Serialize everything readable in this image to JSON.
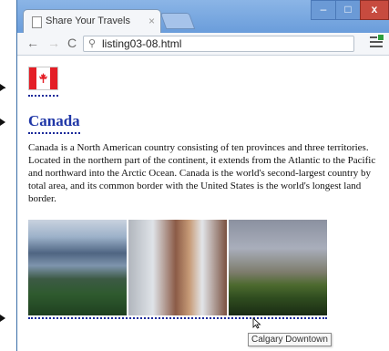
{
  "browser": {
    "tab_title": "Share Your Travels",
    "tab_close": "×",
    "url": "listing03-08.html",
    "window_controls": {
      "minimize": "–",
      "maximize": "□",
      "close": "x"
    },
    "nav": {
      "back": "←",
      "forward": "→",
      "reload": "C",
      "search_icon": "⚲"
    }
  },
  "page": {
    "flag_icon": "canada-flag",
    "heading": "Canada",
    "paragraph": "Canada is a North American country consisting of ten provinces and three territories. Located in the northern part of the continent, it extends from the Atlantic to the Pacific and northward into the Arctic Ocean. Canada is the world's second-largest country by total area, and its common border with the United States is the world's longest land border.",
    "photos": [
      {
        "icon": "mountains-photo"
      },
      {
        "icon": "building-photo"
      },
      {
        "icon": "calgary-photo"
      }
    ],
    "tooltip": "Calgary Downtown"
  },
  "colors": {
    "heading": "#1f36a7",
    "dotted_rule": "#1a2a9a",
    "titlebar": "#6a9ddb",
    "close_button": "#c74b3f"
  }
}
